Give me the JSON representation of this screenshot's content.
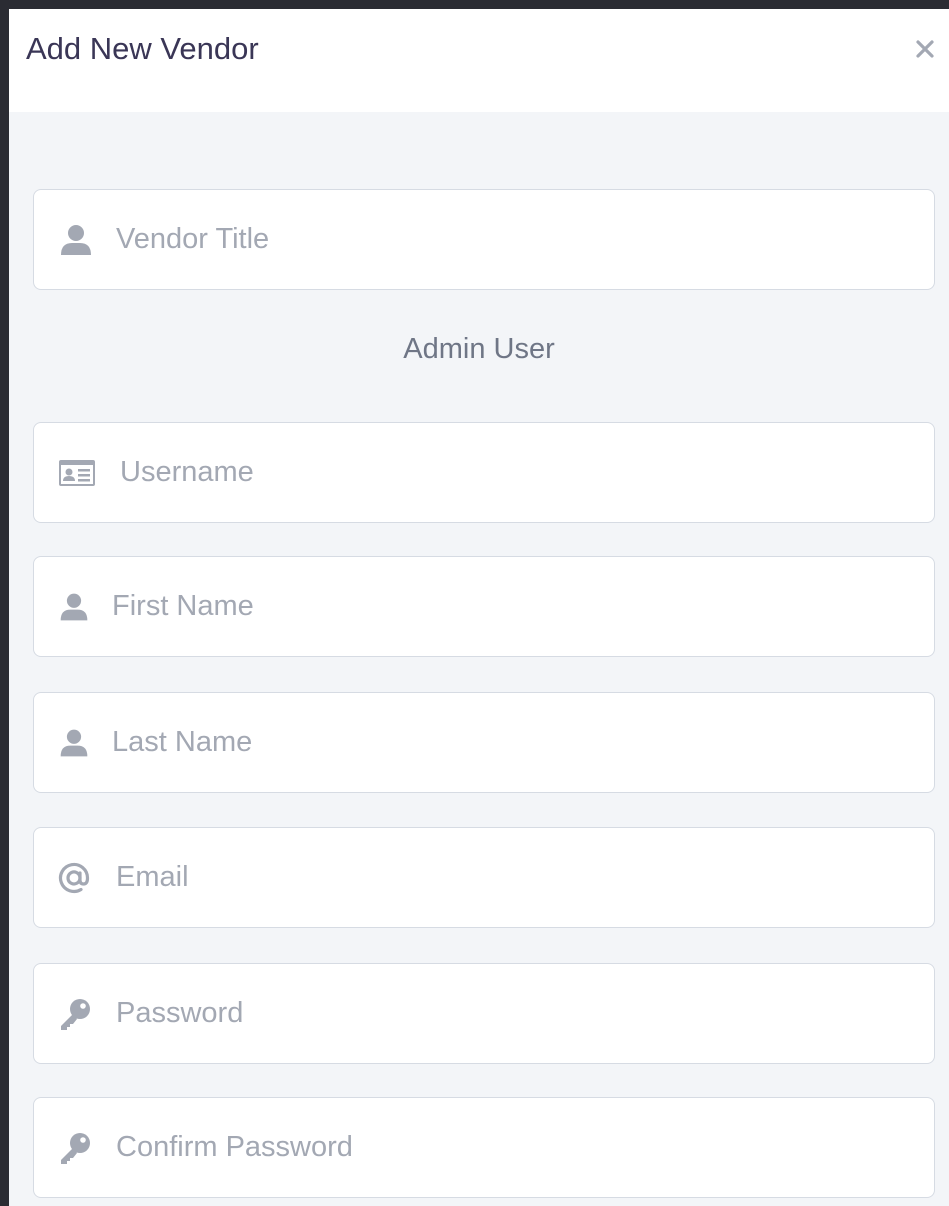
{
  "modal": {
    "title": "Add New Vendor",
    "close_icon": "close-icon"
  },
  "form": {
    "vendor_title": {
      "placeholder": "Vendor Title",
      "icon": "user-icon"
    },
    "section_label": "Admin User",
    "username": {
      "placeholder": "Username",
      "icon": "id-card-icon"
    },
    "first_name": {
      "placeholder": "First Name",
      "icon": "user-icon"
    },
    "last_name": {
      "placeholder": "Last Name",
      "icon": "user-icon"
    },
    "email": {
      "placeholder": "Email",
      "icon": "at-icon"
    },
    "password": {
      "placeholder": "Password",
      "icon": "key-icon"
    },
    "confirm_password": {
      "placeholder": "Confirm Password",
      "icon": "key-icon"
    }
  },
  "colors": {
    "backdrop": "#2b2c33",
    "body_bg": "#f3f5f8",
    "title": "#3a3656",
    "placeholder": "#a3a8b3",
    "icon": "#a3a8b3",
    "border": "#d6dbe3"
  }
}
